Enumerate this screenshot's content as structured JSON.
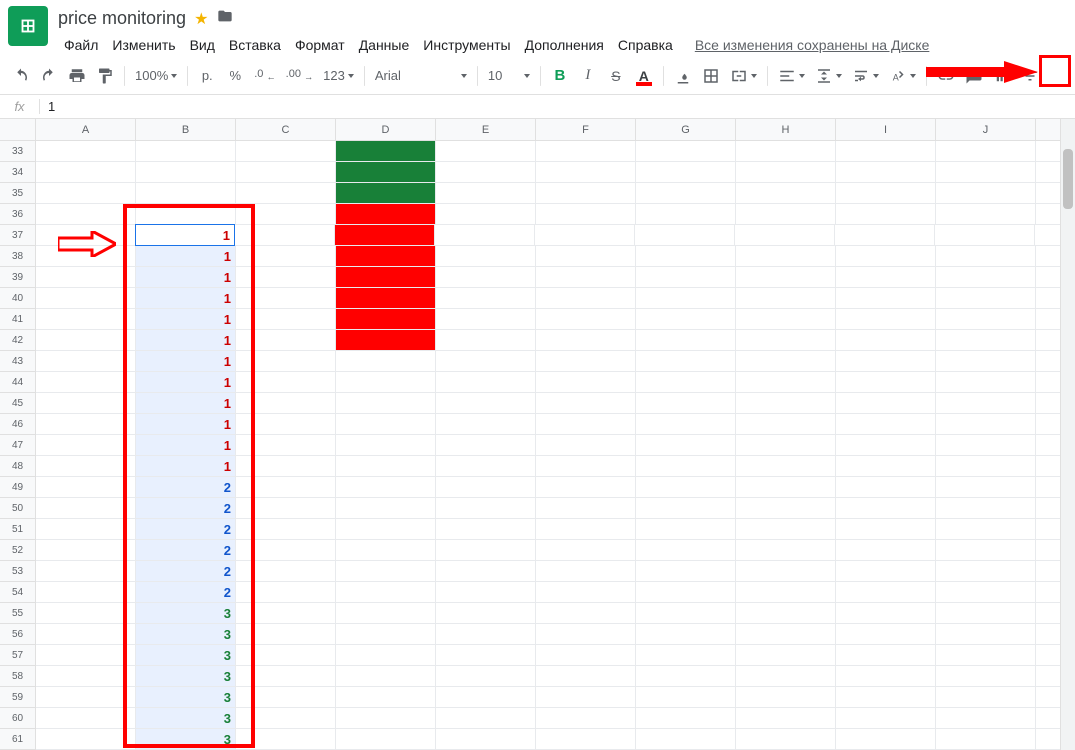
{
  "app": {
    "title": "price monitoring",
    "saved_msg": "Все изменения сохранены на Диске"
  },
  "menus": [
    "Файл",
    "Изменить",
    "Вид",
    "Вставка",
    "Формат",
    "Данные",
    "Инструменты",
    "Дополнения",
    "Справка"
  ],
  "toolbar": {
    "zoom": "100%",
    "currency": "р.",
    "percent": "%",
    "dec_dec": ".0",
    "dec_inc": ".00",
    "num_fmt": "123",
    "font": "Arial",
    "size": "10",
    "bold": "B",
    "italic": "I",
    "strike": "S",
    "text_color": "A"
  },
  "formula_bar": {
    "fx": "fx",
    "value": "1"
  },
  "grid": {
    "cols": [
      "A",
      "B",
      "C",
      "D",
      "E",
      "F",
      "G",
      "H",
      "I",
      "J"
    ],
    "row_start": 33,
    "rows": [
      {
        "r": 33,
        "b": "",
        "d": "green"
      },
      {
        "r": 34,
        "b": "",
        "d": "green"
      },
      {
        "r": 35,
        "b": "",
        "d": "green"
      },
      {
        "r": 36,
        "b": "",
        "d": "red"
      },
      {
        "r": 37,
        "b": "1",
        "bc": "v1",
        "d": "red",
        "active": true
      },
      {
        "r": 38,
        "b": "1",
        "bc": "v1",
        "d": "red"
      },
      {
        "r": 39,
        "b": "1",
        "bc": "v1",
        "d": "red"
      },
      {
        "r": 40,
        "b": "1",
        "bc": "v1",
        "d": "red"
      },
      {
        "r": 41,
        "b": "1",
        "bc": "v1",
        "d": "red"
      },
      {
        "r": 42,
        "b": "1",
        "bc": "v1",
        "d": "red"
      },
      {
        "r": 43,
        "b": "1",
        "bc": "v1",
        "d": ""
      },
      {
        "r": 44,
        "b": "1",
        "bc": "v1",
        "d": ""
      },
      {
        "r": 45,
        "b": "1",
        "bc": "v1",
        "d": ""
      },
      {
        "r": 46,
        "b": "1",
        "bc": "v1",
        "d": ""
      },
      {
        "r": 47,
        "b": "1",
        "bc": "v1",
        "d": ""
      },
      {
        "r": 48,
        "b": "1",
        "bc": "v1",
        "d": ""
      },
      {
        "r": 49,
        "b": "2",
        "bc": "v2",
        "d": ""
      },
      {
        "r": 50,
        "b": "2",
        "bc": "v2",
        "d": ""
      },
      {
        "r": 51,
        "b": "2",
        "bc": "v2",
        "d": ""
      },
      {
        "r": 52,
        "b": "2",
        "bc": "v2",
        "d": ""
      },
      {
        "r": 53,
        "b": "2",
        "bc": "v2",
        "d": ""
      },
      {
        "r": 54,
        "b": "2",
        "bc": "v2",
        "d": ""
      },
      {
        "r": 55,
        "b": "3",
        "bc": "v3",
        "d": ""
      },
      {
        "r": 56,
        "b": "3",
        "bc": "v3",
        "d": ""
      },
      {
        "r": 57,
        "b": "3",
        "bc": "v3",
        "d": ""
      },
      {
        "r": 58,
        "b": "3",
        "bc": "v3",
        "d": ""
      },
      {
        "r": 59,
        "b": "3",
        "bc": "v3",
        "d": ""
      },
      {
        "r": 60,
        "b": "3",
        "bc": "v3",
        "d": ""
      },
      {
        "r": 61,
        "b": "3",
        "bc": "v3",
        "d": ""
      }
    ]
  }
}
